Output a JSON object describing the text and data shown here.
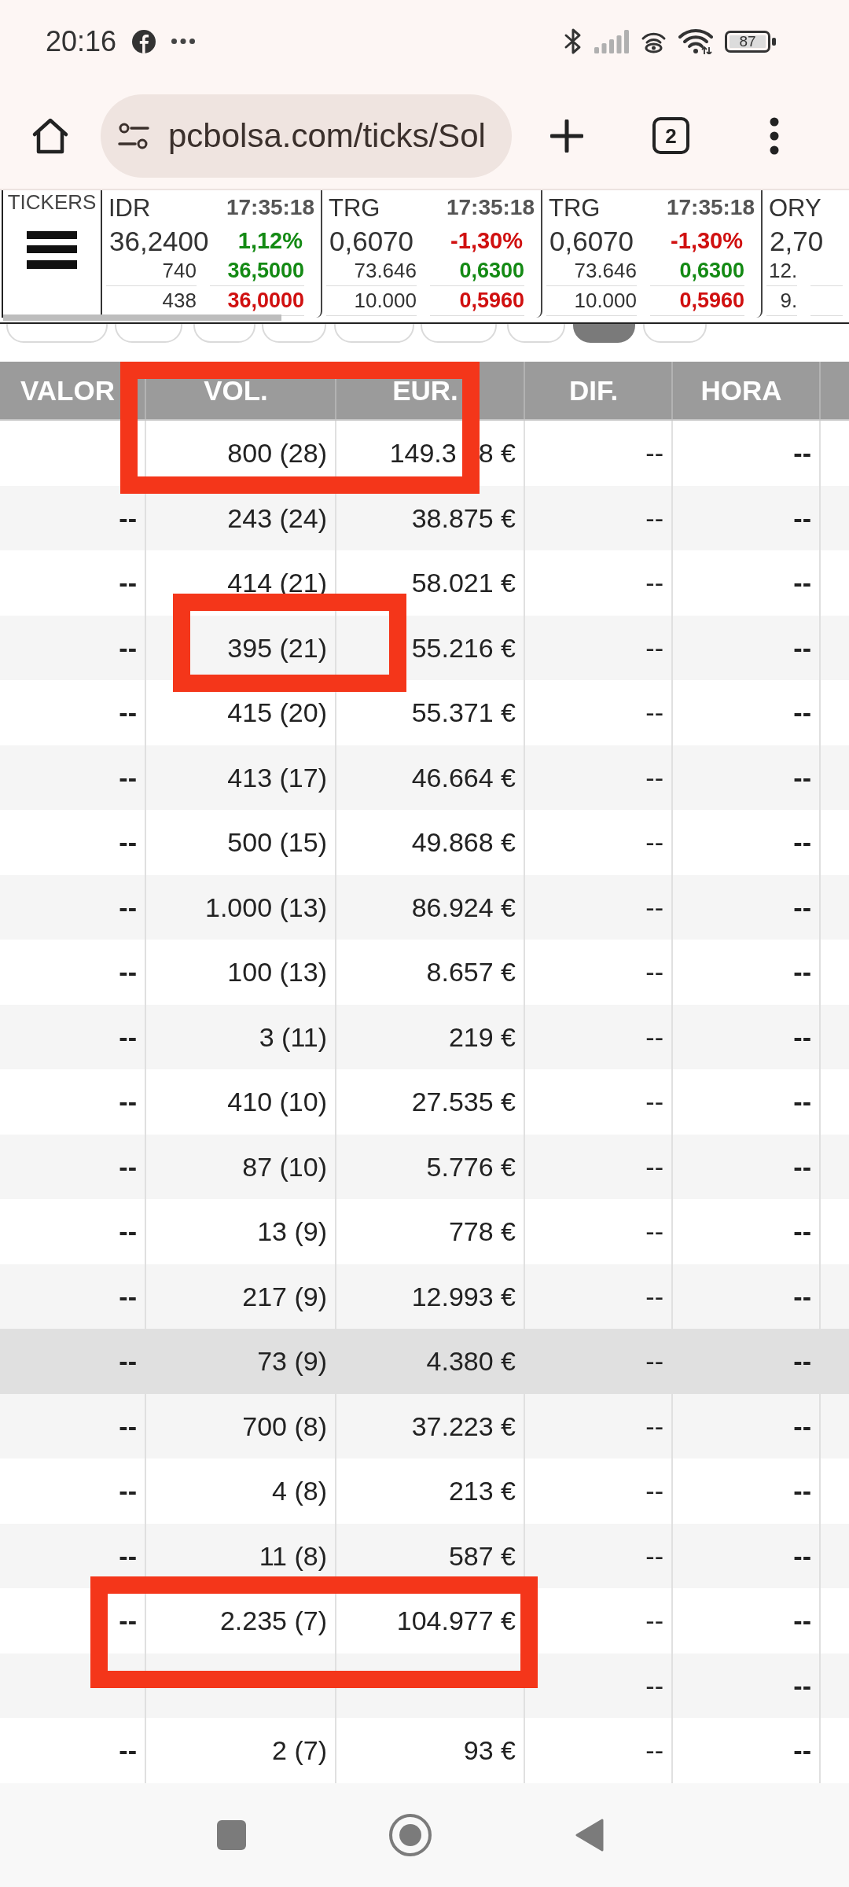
{
  "status_bar": {
    "time": "20:16",
    "battery": "87"
  },
  "browser": {
    "url": "pcbolsa.com/ticks/Sol",
    "tab_count": "2"
  },
  "tickers": {
    "label": "TICKERS",
    "items": [
      {
        "symbol": "IDR",
        "time": "17:35:18",
        "price": "36,2400",
        "change": "1,12%",
        "color": "#148a14",
        "volume_1": "740",
        "price_1": "36,5000",
        "volume_2": "438",
        "price_2": "36,0000"
      },
      {
        "symbol": "TRG",
        "time": "17:35:18",
        "price": "0,6070",
        "change": "-1,30%",
        "color": "#d01010",
        "volume_1": "73.646",
        "price_1": "0,6300",
        "volume_2": "10.000",
        "price_2": "0,5960"
      },
      {
        "symbol": "TRG",
        "time": "17:35:18",
        "price": "0,6070",
        "change": "-1,30%",
        "color": "#d01010",
        "volume_1": "73.646",
        "price_1": "0,6300",
        "volume_2": "10.000",
        "price_2": "0,5960"
      },
      {
        "symbol": "ORY",
        "price": "2,70",
        "volume_1": "12.",
        "volume_2": "9."
      }
    ]
  },
  "filter_tabs": [
    {
      "selected": false
    },
    {
      "selected": false
    },
    {
      "selected": false
    },
    {
      "selected": false
    },
    {
      "selected": false
    },
    {
      "selected": false
    },
    {
      "selected": false
    },
    {
      "selected": true
    },
    {
      "selected": false
    }
  ],
  "table": {
    "columns": [
      "VALOR",
      "VOL.",
      "EUR.",
      "DIF.",
      "HORA"
    ],
    "rows": [
      {
        "vol": "800 (28)",
        "eur": [
          "149.3",
          "8 €"
        ],
        "dif": "--",
        "hora": "--",
        "selected": false
      },
      {
        "valor": "--",
        "vol": "243 (24)",
        "eur": "38.875 €",
        "dif": "--",
        "hora": "--",
        "selected": false
      },
      {
        "valor": "--",
        "vol": "414 (21)",
        "eur": "58.021 €",
        "dif": "--",
        "hora": "--",
        "selected": false
      },
      {
        "valor": "--",
        "vol": "395 (21)",
        "eur": "55.216 €",
        "dif": "--",
        "hora": "--",
        "selected": false
      },
      {
        "valor": "--",
        "vol": "415 (20)",
        "eur": "55.371 €",
        "dif": "--",
        "hora": "--",
        "selected": false
      },
      {
        "valor": "--",
        "vol": "413 (17)",
        "eur": "46.664 €",
        "dif": "--",
        "hora": "--",
        "selected": false
      },
      {
        "valor": "--",
        "vol": "500 (15)",
        "eur": "49.868 €",
        "dif": "--",
        "hora": "--",
        "selected": false
      },
      {
        "valor": "--",
        "vol": "1.000 (13)",
        "eur": "86.924 €",
        "dif": "--",
        "hora": "--",
        "selected": false
      },
      {
        "valor": "--",
        "vol": "100 (13)",
        "eur": "8.657 €",
        "dif": "--",
        "hora": "--",
        "selected": false
      },
      {
        "valor": "--",
        "vol": "3 (11)",
        "eur": "219 €",
        "dif": "--",
        "hora": "--",
        "selected": false
      },
      {
        "valor": "--",
        "vol": "410 (10)",
        "eur": "27.535 €",
        "dif": "--",
        "hora": "--",
        "selected": false
      },
      {
        "valor": "--",
        "vol": "87 (10)",
        "eur": "5.776 €",
        "dif": "--",
        "hora": "--",
        "selected": false
      },
      {
        "valor": "--",
        "vol": "13 (9)",
        "eur": "778 €",
        "dif": "--",
        "hora": "--",
        "selected": false
      },
      {
        "valor": "--",
        "vol": "217 (9)",
        "eur": "12.993 €",
        "dif": "--",
        "hora": "--",
        "selected": false
      },
      {
        "valor": "--",
        "vol": "73 (9)",
        "eur": "4.380 €",
        "dif": "--",
        "hora": "--",
        "selected": true
      },
      {
        "valor": "--",
        "vol": "700 (8)",
        "eur": "37.223 €",
        "dif": "--",
        "hora": "--",
        "selected": false
      },
      {
        "valor": "--",
        "vol": "4 (8)",
        "eur": "213 €",
        "dif": "--",
        "hora": "--",
        "selected": false
      },
      {
        "valor": "--",
        "vol": "11 (8)",
        "eur": "587 €",
        "dif": "--",
        "hora": "--",
        "selected": false
      },
      {
        "valor": "--",
        "vol": "2.235 (7)",
        "eur": "104.977 €",
        "dif": "--",
        "hora": "--",
        "selected": false
      },
      {
        "dif": "--",
        "hora": "--",
        "selected": false
      },
      {
        "valor": "--",
        "vol": "2 (7)",
        "eur": "93 €",
        "dif": "--",
        "hora": "--",
        "selected": false
      }
    ]
  }
}
